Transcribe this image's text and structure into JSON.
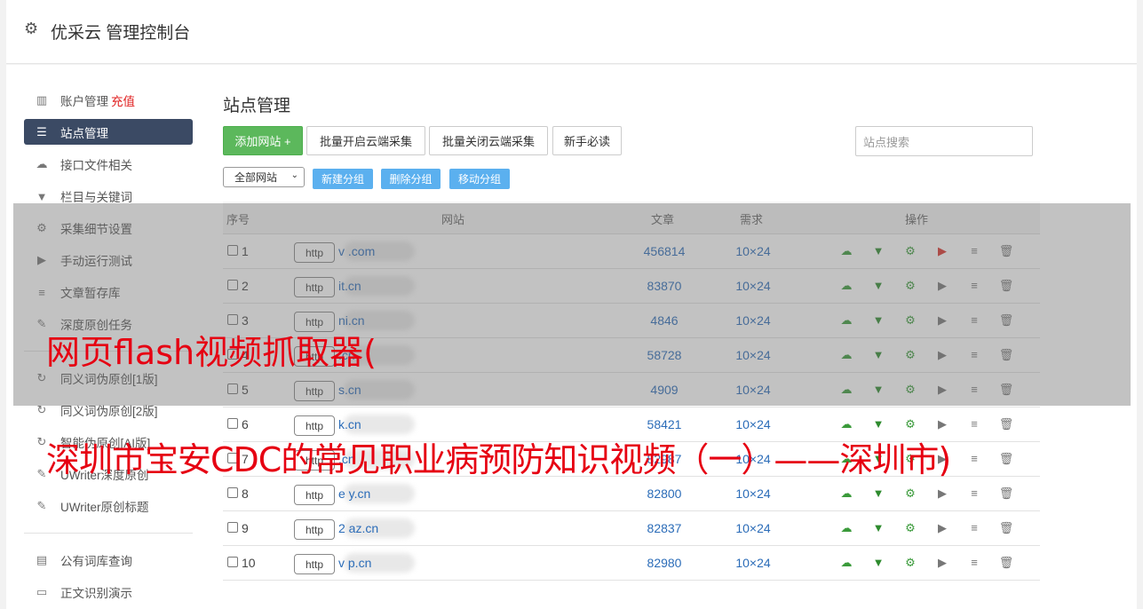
{
  "header": {
    "title": "优采云 管理控制台"
  },
  "sidebar": {
    "items": [
      {
        "label": "账户管理",
        "extra": "充值",
        "icon": "bar-chart-icon"
      },
      {
        "label": "站点管理",
        "icon": "server-icon",
        "active": true
      },
      {
        "label": "接口文件相关",
        "icon": "cloud-upload-icon"
      },
      {
        "label": "栏目与关键词",
        "icon": "filter-icon"
      },
      {
        "label": "采集细节设置",
        "icon": "cogs-icon"
      },
      {
        "label": "手动运行测试",
        "icon": "play-icon"
      },
      {
        "label": "文章暂存库",
        "icon": "database-icon"
      },
      {
        "label": "深度原创任务",
        "icon": "edit-icon"
      }
    ],
    "items2": [
      {
        "label": "同义词伪原创[1版]",
        "icon": "refresh-icon"
      },
      {
        "label": "同义词伪原创[2版]",
        "icon": "refresh-icon"
      },
      {
        "label": "智能伪原创[AI版]",
        "icon": "refresh-icon"
      },
      {
        "label": "UWriter深度原创",
        "icon": "edit-icon"
      },
      {
        "label": "UWriter原创标题",
        "icon": "edit-icon"
      }
    ],
    "items3": [
      {
        "label": "公有词库查询",
        "icon": "book-icon"
      },
      {
        "label": "正文识别演示",
        "icon": "monitor-icon"
      }
    ]
  },
  "main": {
    "page_title": "站点管理",
    "buttons": {
      "add_site": "添加网站 +",
      "batch_enable": "批量开启云端采集",
      "batch_disable": "批量关闭云端采集",
      "newbie": "新手必读"
    },
    "search_placeholder": "站点搜索",
    "group_select": "全部网站",
    "group_buttons": {
      "new": "新建分组",
      "delete": "删除分组",
      "move": "移动分组"
    },
    "table": {
      "headers": {
        "index": "序号",
        "site": "网站",
        "articles": "文章",
        "demand": "需求",
        "ops": "操作"
      },
      "rows": [
        {
          "num": "1",
          "proto": "http",
          "site": "v               .com",
          "articles": "456814",
          "demand": "10×24",
          "play_active": true
        },
        {
          "num": "2",
          "proto": "http",
          "site": "          it.cn",
          "articles": "83870",
          "demand": "10×24"
        },
        {
          "num": "3",
          "proto": "http",
          "site": "          ni.cn",
          "articles": "4846",
          "demand": "10×24"
        },
        {
          "num": "4",
          "proto": "http",
          "site": "          .cn",
          "articles": "58728",
          "demand": "10×24"
        },
        {
          "num": "5",
          "proto": "http",
          "site": "          s.cn",
          "articles": "4909",
          "demand": "10×24"
        },
        {
          "num": "6",
          "proto": "http",
          "site": "          k.cn",
          "articles": "58421",
          "demand": "10×24"
        },
        {
          "num": "7",
          "proto": "http",
          "site": "          .cn",
          "articles": "82987",
          "demand": "10×24"
        },
        {
          "num": "8",
          "proto": "http",
          "site": "e       y.cn",
          "articles": "82800",
          "demand": "10×24"
        },
        {
          "num": "9",
          "proto": "http",
          "site": "2       az.cn",
          "articles": "82837",
          "demand": "10×24"
        },
        {
          "num": "10",
          "proto": "http",
          "site": "v       p.cn",
          "articles": "82980",
          "demand": "10×24"
        }
      ]
    }
  },
  "captions": {
    "line1": "网页flash视频抓取器(",
    "line2": "深圳市宝安CDC的常见职业病预防知识视频（一）——深圳市)"
  }
}
